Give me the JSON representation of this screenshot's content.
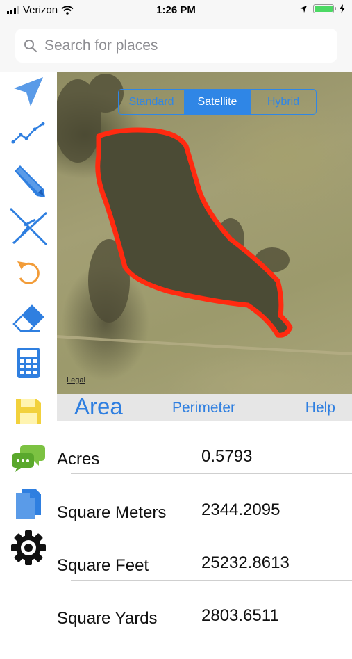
{
  "status_bar": {
    "carrier": "Verizon",
    "time": "1:26 PM"
  },
  "search": {
    "placeholder": "Search for places"
  },
  "sidebar": {
    "tools": [
      "location-arrow-icon",
      "line-chart-icon",
      "pencil-icon",
      "crosshair-icon",
      "undo-icon",
      "eraser-icon",
      "calculator-icon",
      "save-icon",
      "chat-icon",
      "documents-icon",
      "settings-gear-icon"
    ]
  },
  "map": {
    "map_types": [
      "Standard",
      "Satellite",
      "Hybrid"
    ],
    "selected_map_type": "Satellite",
    "legal_label": "Legal",
    "polygon_color": "#ff2a10"
  },
  "tabs": {
    "area": "Area",
    "perimeter": "Perimeter",
    "help": "Help"
  },
  "results": [
    {
      "label": "Acres",
      "value": "0.5793"
    },
    {
      "label": "Square Meters",
      "value": "2344.2095"
    },
    {
      "label": "Square Feet",
      "value": "25232.8613"
    },
    {
      "label": "Square Yards",
      "value": "2803.6511"
    }
  ],
  "colors": {
    "accent": "#2f7fe0",
    "undo": "#f29c38",
    "save": "#f2d13c",
    "chat": "#7cc242",
    "battery": "#4cd964"
  }
}
